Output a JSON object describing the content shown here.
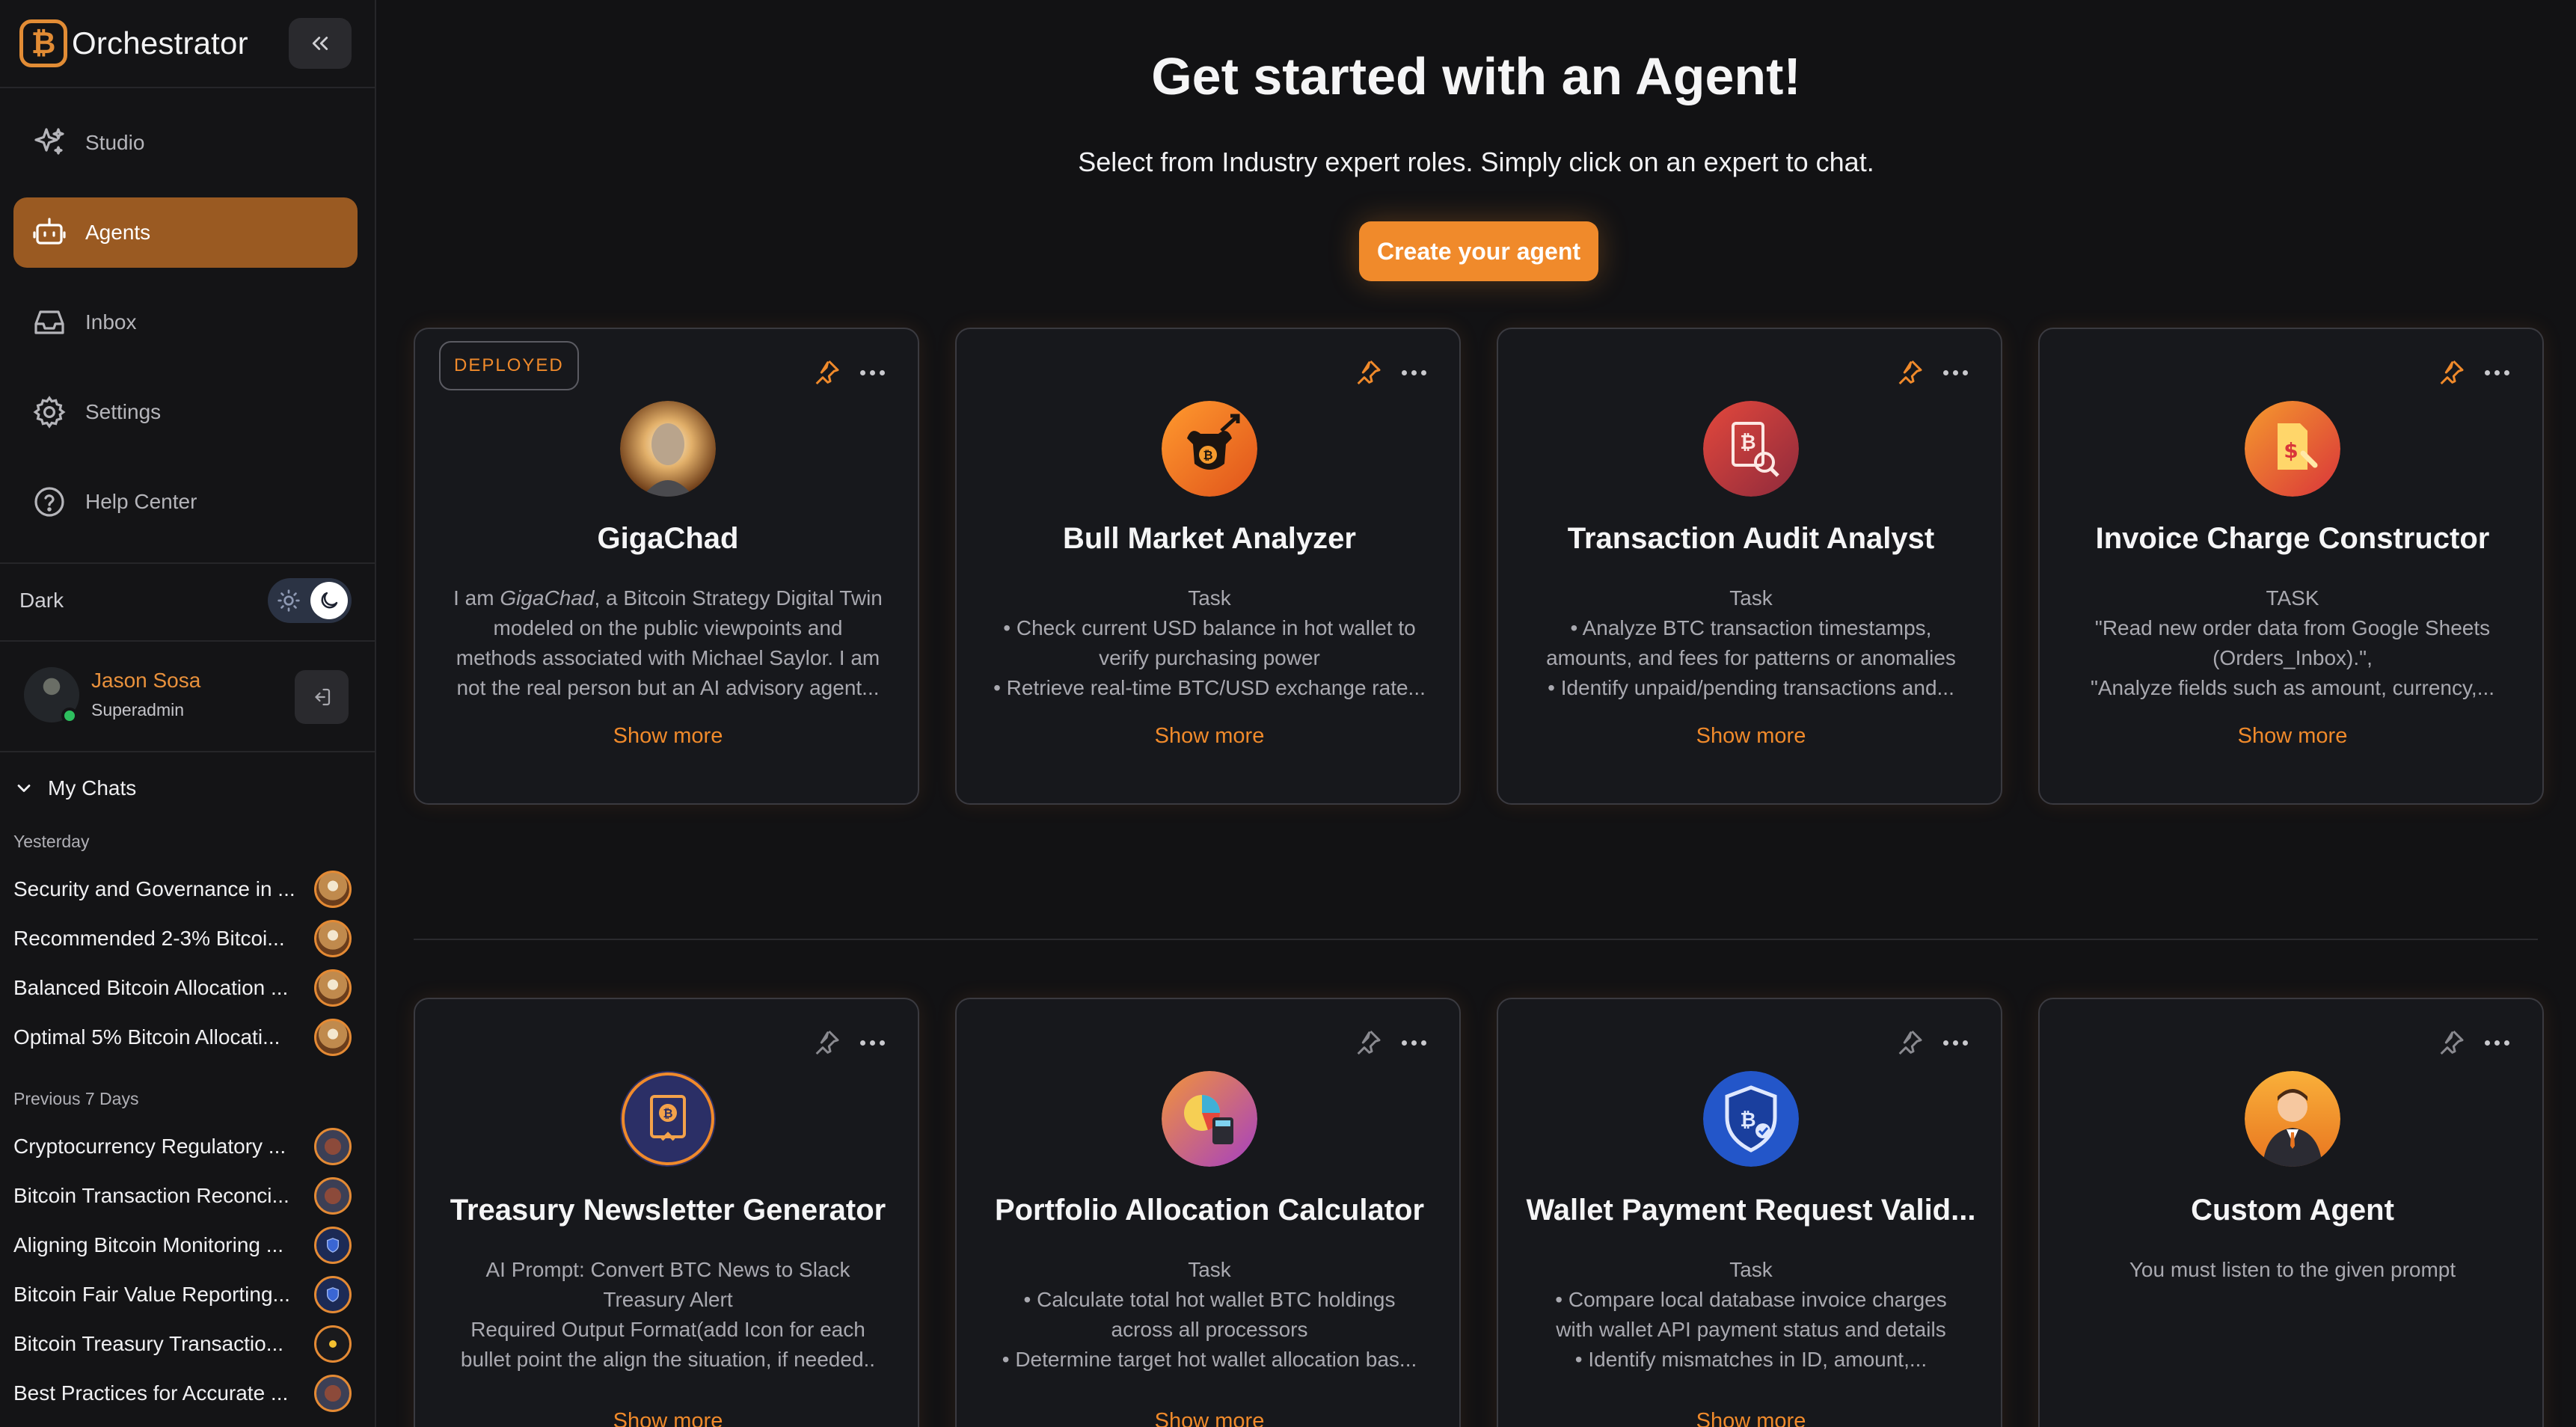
{
  "sidebar": {
    "brand": "Orchestrator",
    "brand_logo_icon": "bitcoin-icon",
    "collapse_icon": "double-chevron-left-icon",
    "nav": [
      {
        "label": "Studio",
        "icon": "sparkles-icon",
        "active": false
      },
      {
        "label": "Agents",
        "icon": "robot-icon",
        "active": true
      },
      {
        "label": "Inbox",
        "icon": "inbox-icon",
        "active": false
      },
      {
        "label": "Settings",
        "icon": "gear-icon",
        "active": false
      },
      {
        "label": "Help Center",
        "icon": "help-circle-icon",
        "active": false
      }
    ],
    "theme": {
      "label": "Dark",
      "mode": "dark"
    },
    "user": {
      "name": "Jason Sosa",
      "role": "Superadmin",
      "status": "online"
    },
    "chats": {
      "title": "My Chats",
      "groups": [
        {
          "label": "Yesterday",
          "items": [
            {
              "title": "Security and Governance in ...",
              "avatar": "gigachad"
            },
            {
              "title": "Recommended 2-3% Bitcoi...",
              "avatar": "gigachad"
            },
            {
              "title": "Balanced Bitcoin Allocation ...",
              "avatar": "gigachad"
            },
            {
              "title": "Optimal 5% Bitcoin Allocati...",
              "avatar": "gigachad"
            }
          ]
        },
        {
          "label": "Previous 7 Days",
          "items": [
            {
              "title": "Cryptocurrency Regulatory ...",
              "avatar": "audit"
            },
            {
              "title": "Bitcoin Transaction Reconci...",
              "avatar": "audit"
            },
            {
              "title": "Aligning Bitcoin Monitoring ...",
              "avatar": "shield"
            },
            {
              "title": "Bitcoin Fair Value Reporting...",
              "avatar": "shield"
            },
            {
              "title": "Bitcoin Treasury Transactio...",
              "avatar": "sun"
            },
            {
              "title": "Best Practices for Accurate ...",
              "avatar": "audit"
            }
          ]
        }
      ]
    }
  },
  "main": {
    "title": "Get started with an Agent!",
    "subtitle": "Select from Industry expert roles. Simply click on an expert to chat.",
    "create_button": "Create your agent",
    "show_more_label": "Show more",
    "deployed_label": "DEPLOYED",
    "agents": [
      {
        "name": "GigaChad",
        "deployed": true,
        "avatar": "gigachad-portrait",
        "desc": [
          "I am GigaChad, a Bitcoin Strategy Digital Twin",
          "modeled on the public viewpoints and",
          "methods associated with Michael Saylor. I am",
          "not the real person but an AI advisory agent..."
        ],
        "show_more": true
      },
      {
        "name": "Bull Market Analyzer",
        "deployed": false,
        "avatar": "bull-bitcoin-icon",
        "desc": [
          "Task",
          "• Check current USD balance in hot wallet to",
          "verify purchasing power",
          "• Retrieve real-time BTC/USD exchange rate..."
        ],
        "show_more": true
      },
      {
        "name": "Transaction Audit Analyst",
        "deployed": false,
        "avatar": "bitcoin-document-search-icon",
        "desc": [
          "Task",
          "• Analyze BTC transaction timestamps,",
          "amounts, and fees for patterns or anomalies",
          "• Identify unpaid/pending transactions and..."
        ],
        "show_more": true
      },
      {
        "name": "Invoice Charge Constructor",
        "deployed": false,
        "avatar": "invoice-wrench-icon",
        "desc": [
          "TASK",
          "\"Read new order data from Google Sheets",
          "(Orders_Inbox).\",",
          "\"Analyze fields such as amount, currency,..."
        ],
        "show_more": true
      },
      {
        "name": "Treasury Newsletter Generator",
        "deployed": false,
        "avatar": "bitcoin-certificate-icon",
        "desc": [
          "AI Prompt: Convert BTC News to Slack",
          "Treasury Alert",
          "Required Output Format(add Icon for each",
          "bullet point the align the situation, if needed.."
        ],
        "show_more": true
      },
      {
        "name": "Portfolio Allocation Calculator",
        "deployed": false,
        "avatar": "pie-calculator-icon",
        "desc": [
          "Task",
          "• Calculate total hot wallet BTC holdings",
          "across all processors",
          "• Determine target hot wallet allocation bas..."
        ],
        "show_more": true
      },
      {
        "name": "Wallet Payment Request Valid...",
        "deployed": false,
        "avatar": "shield-bitcoin-icon",
        "desc": [
          "Task",
          "• Compare local database invoice charges",
          "with wallet API payment status and details",
          "• Identify mismatches in ID, amount,..."
        ],
        "show_more": true
      },
      {
        "name": "Custom Agent",
        "deployed": false,
        "avatar": "businessman-icon",
        "desc": [
          "You must listen to the given prompt"
        ],
        "show_more": false
      }
    ]
  },
  "colors": {
    "accent": "#f08a2b",
    "active_nav": "#9a5a22",
    "background": "#121214",
    "card": "#17181c"
  }
}
